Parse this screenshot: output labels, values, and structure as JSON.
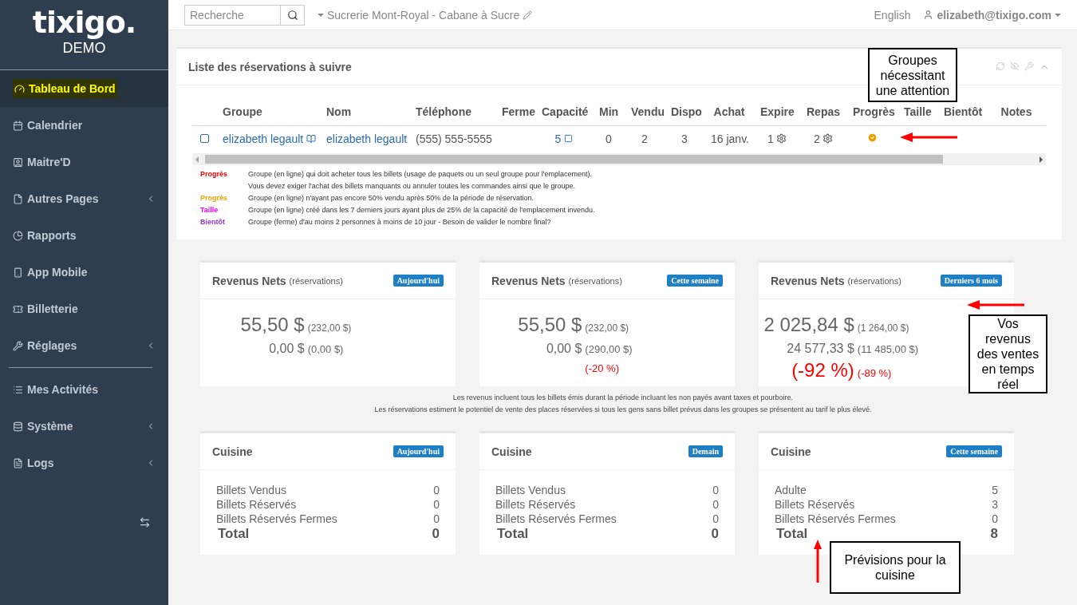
{
  "sidebar": {
    "logo": "tixigo.",
    "subtitle": "DEMO",
    "sections": [
      [
        {
          "label": "Tableau de Bord",
          "selected": true,
          "submenu": false
        },
        {
          "label": "Calendrier",
          "selected": false,
          "submenu": false
        },
        {
          "label": "Maitre'D",
          "selected": false,
          "submenu": false
        },
        {
          "label": "Autres Pages",
          "selected": false,
          "submenu": true
        },
        {
          "label": "Rapports",
          "selected": false,
          "submenu": false
        },
        {
          "label": "App Mobile",
          "selected": false,
          "submenu": false
        },
        {
          "label": "Billetterie",
          "selected": false,
          "submenu": false
        },
        {
          "label": "Réglages",
          "selected": false,
          "submenu": true
        }
      ],
      [
        {
          "label": "Mes Activités",
          "selected": false,
          "submenu": false
        },
        {
          "label": "Système",
          "selected": false,
          "submenu": true
        },
        {
          "label": "Logs",
          "selected": false,
          "submenu": true
        }
      ]
    ]
  },
  "topbar": {
    "search": {
      "placeholder": "Recherche"
    },
    "location": "Sucrerie Mont-Royal - Cabane à Sucre",
    "language": "English",
    "user": "elizabeth@tixigo.com"
  },
  "reservations": {
    "title": "Liste des réservations à suivre",
    "columns": [
      "Groupe",
      "Nom",
      "Téléphone",
      "Ferme",
      "Capacité",
      "Min",
      "Vendu",
      "Dispo",
      "Achat",
      "Expire",
      "Repas",
      "Progrès",
      "Taille",
      "Bientôt",
      "Notes"
    ],
    "rows": [
      {
        "checked": false,
        "cells": [
          {
            "kind": "link-book",
            "text": "elizabeth legault"
          },
          {
            "kind": "link",
            "text": "elizabeth legault"
          },
          {
            "kind": "text",
            "text": "(555) 555-5555"
          },
          {
            "kind": "empty"
          },
          {
            "kind": "link-box",
            "text": "5"
          },
          {
            "kind": "text",
            "text": "0"
          },
          {
            "kind": "text",
            "text": "2"
          },
          {
            "kind": "text",
            "text": "3"
          },
          {
            "kind": "text",
            "text": "16 janv."
          },
          {
            "kind": "gear",
            "text": "1"
          },
          {
            "kind": "gear",
            "text": "2"
          },
          {
            "kind": "flag",
            "on": true
          },
          {
            "kind": "empty"
          },
          {
            "kind": "empty"
          },
          {
            "kind": "empty"
          }
        ]
      }
    ],
    "legend": [
      {
        "label": "Progrès",
        "color": "#ff0000",
        "lines": [
          "Groupe (en ligne) qui doit acheter tous les billets (usage de paquets ou un seul groupe pour l'emplacement).",
          "Vous devez exiger l'achat des billets manquants ou annuler toutes les commandes ainsi que le groupe."
        ]
      },
      {
        "label": "Progrès",
        "color": "#f0a000",
        "lines": [
          "Groupe (en ligne) n'ayant pas encore 50% vendu après 50% de la période de réservation."
        ]
      },
      {
        "label": "Taille",
        "color": "#ff00ff",
        "lines": [
          "Groupe (en ligne) créé dans les 7 derniers jours ayant plus de 25% de la capacité de l'emplacement invendu."
        ]
      },
      {
        "label": "Bientôt",
        "color": "#9933cc",
        "lines": [
          "Groupe (ferme) d'au moins 2 personnes à moins de 10 jour - Besoin de valider le nombre final?"
        ]
      }
    ]
  },
  "revenue_cards": [
    {
      "title": "Revenus Nets",
      "subtitle": "(réservations)",
      "badge": "Aujourd'hui",
      "value": "55,50 $",
      "value_compare": "(232,00 $)",
      "booked": "0,00 $",
      "booked_compare": "(0,00 $)"
    },
    {
      "title": "Revenus Nets",
      "subtitle": "(réservations)",
      "badge": "Cette semaine",
      "value": "55,50 $",
      "value_compare": "(232,00 $)",
      "booked": "0,00 $",
      "booked_compare": "(290,00 $)",
      "change_compare": "(-20 %)"
    },
    {
      "title": "Revenus Nets",
      "subtitle": "(réservations)",
      "badge": "Derniers 6 mois",
      "value": "2 025,84 $",
      "value_compare": "(1 264,00 $)",
      "booked": "24 577,33 $",
      "booked_compare": "(11 485,00 $)",
      "change": "(-92 %)",
      "change_compare": "(-89 %)"
    }
  ],
  "revenue_notes": [
    "Les revenus incluent tous les billets émis durant la période incluant les non payés avant taxes et pourboire.",
    "Les réservations estiment le potentiel de vente des places réservées si tous les gens sans billet prévus dans les groupes se présentent au tarif le plus élevé."
  ],
  "kitchen_cards": [
    {
      "title": "Cuisine",
      "badge": "Aujourd'hui",
      "rows": [
        {
          "label": "Billets Vendus",
          "value": "0"
        },
        {
          "label": "Billets Réservés",
          "value": "0"
        },
        {
          "label": "Billets Réservés Fermes",
          "value": "0"
        }
      ],
      "total": {
        "label": "Total",
        "value": "0"
      }
    },
    {
      "title": "Cuisine",
      "badge": "Demain",
      "rows": [
        {
          "label": "Billets Vendus",
          "value": "0"
        },
        {
          "label": "Billets Réservés",
          "value": "0"
        },
        {
          "label": "Billets Réservés Fermes",
          "value": "0"
        }
      ],
      "total": {
        "label": "Total",
        "value": "0"
      }
    },
    {
      "title": "Cuisine",
      "badge": "Cette semaine",
      "rows": [
        {
          "label": "Adulte",
          "value": "5"
        },
        {
          "label": "Billets Réservés",
          "value": "3"
        },
        {
          "label": "Billets Réservés Fermes",
          "value": "0"
        }
      ],
      "total": {
        "label": "Total",
        "value": "8"
      }
    }
  ],
  "callouts": [
    "Groupes nécessitant une attention",
    "Vos revenus des ventes en temps réel",
    "Prévisions pour la cuisine"
  ]
}
